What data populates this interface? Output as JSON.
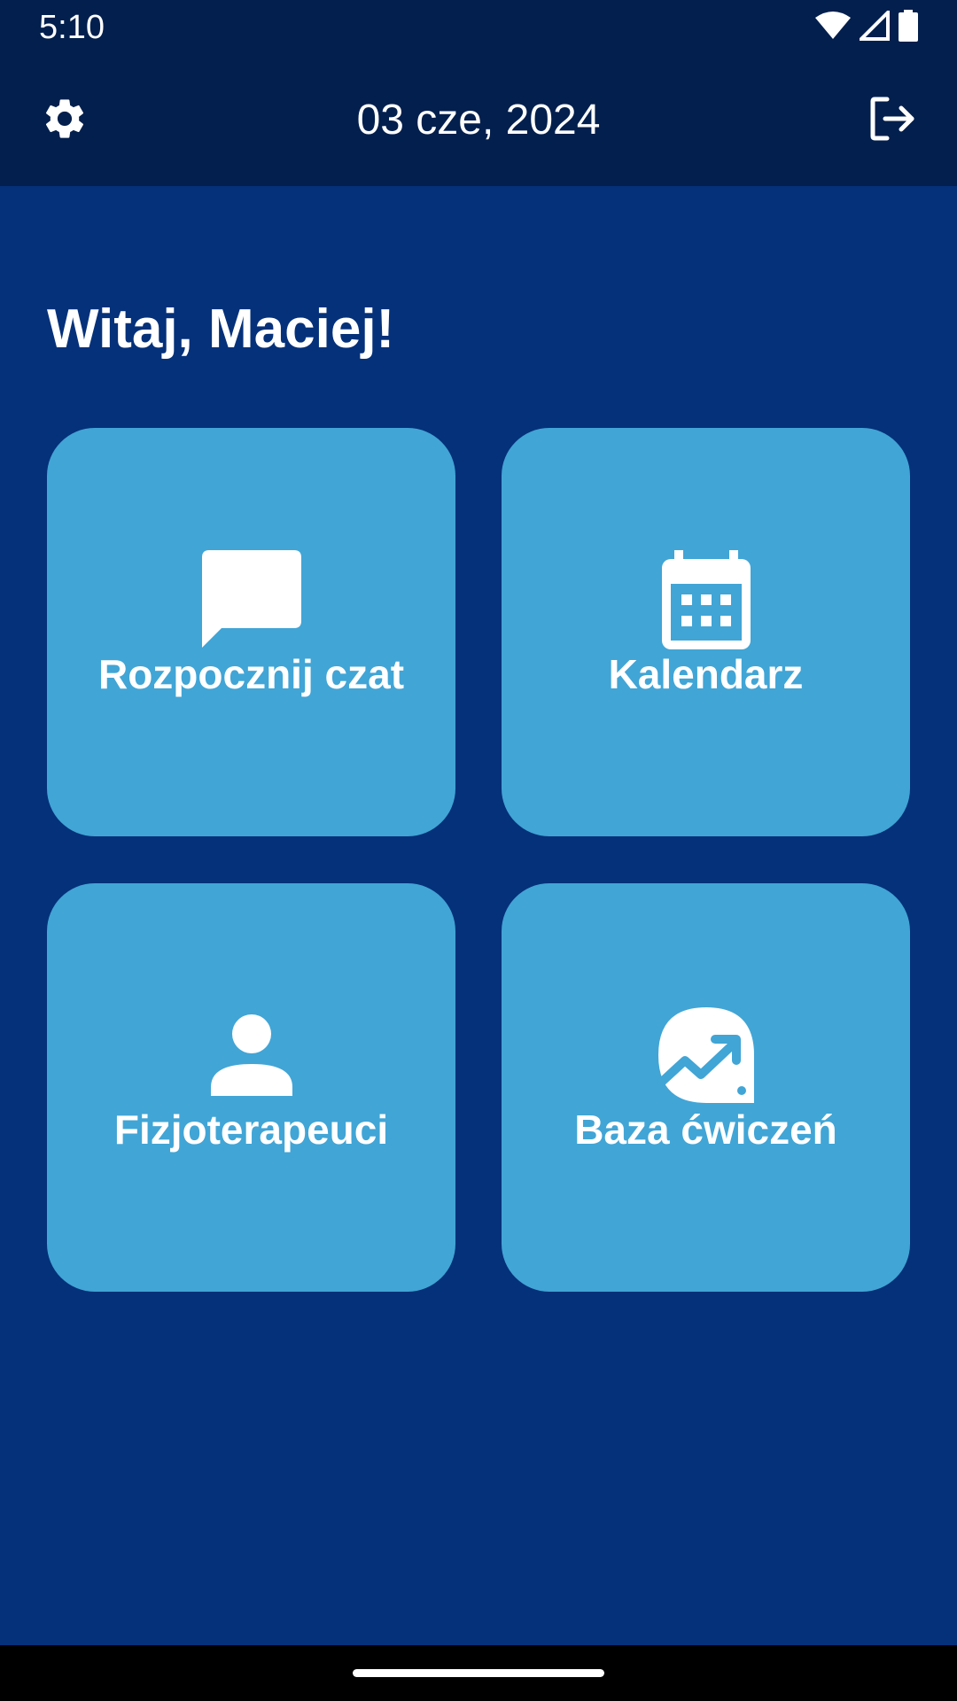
{
  "status_bar": {
    "time": "5:10",
    "icons": [
      "wifi-icon",
      "cell-signal-icon",
      "battery-icon"
    ]
  },
  "app_bar": {
    "date": "03 cze, 2024",
    "left_icon": "gear-icon",
    "right_icon": "logout-icon"
  },
  "greeting": "Witaj, Maciej!",
  "tiles": [
    {
      "label": "Rozpocznij czat",
      "icon": "chat-bubble-icon"
    },
    {
      "label": "Kalendarz",
      "icon": "calendar-icon"
    },
    {
      "label": "Fizjoterapeuci",
      "icon": "person-icon"
    },
    {
      "label": "Baza ćwiczeń",
      "icon": "exercise-progress-icon"
    }
  ],
  "colors": {
    "header_background": "#031f4d",
    "page_background": "#05317a",
    "tile_background": "#41a5d6",
    "text": "#ffffff"
  }
}
